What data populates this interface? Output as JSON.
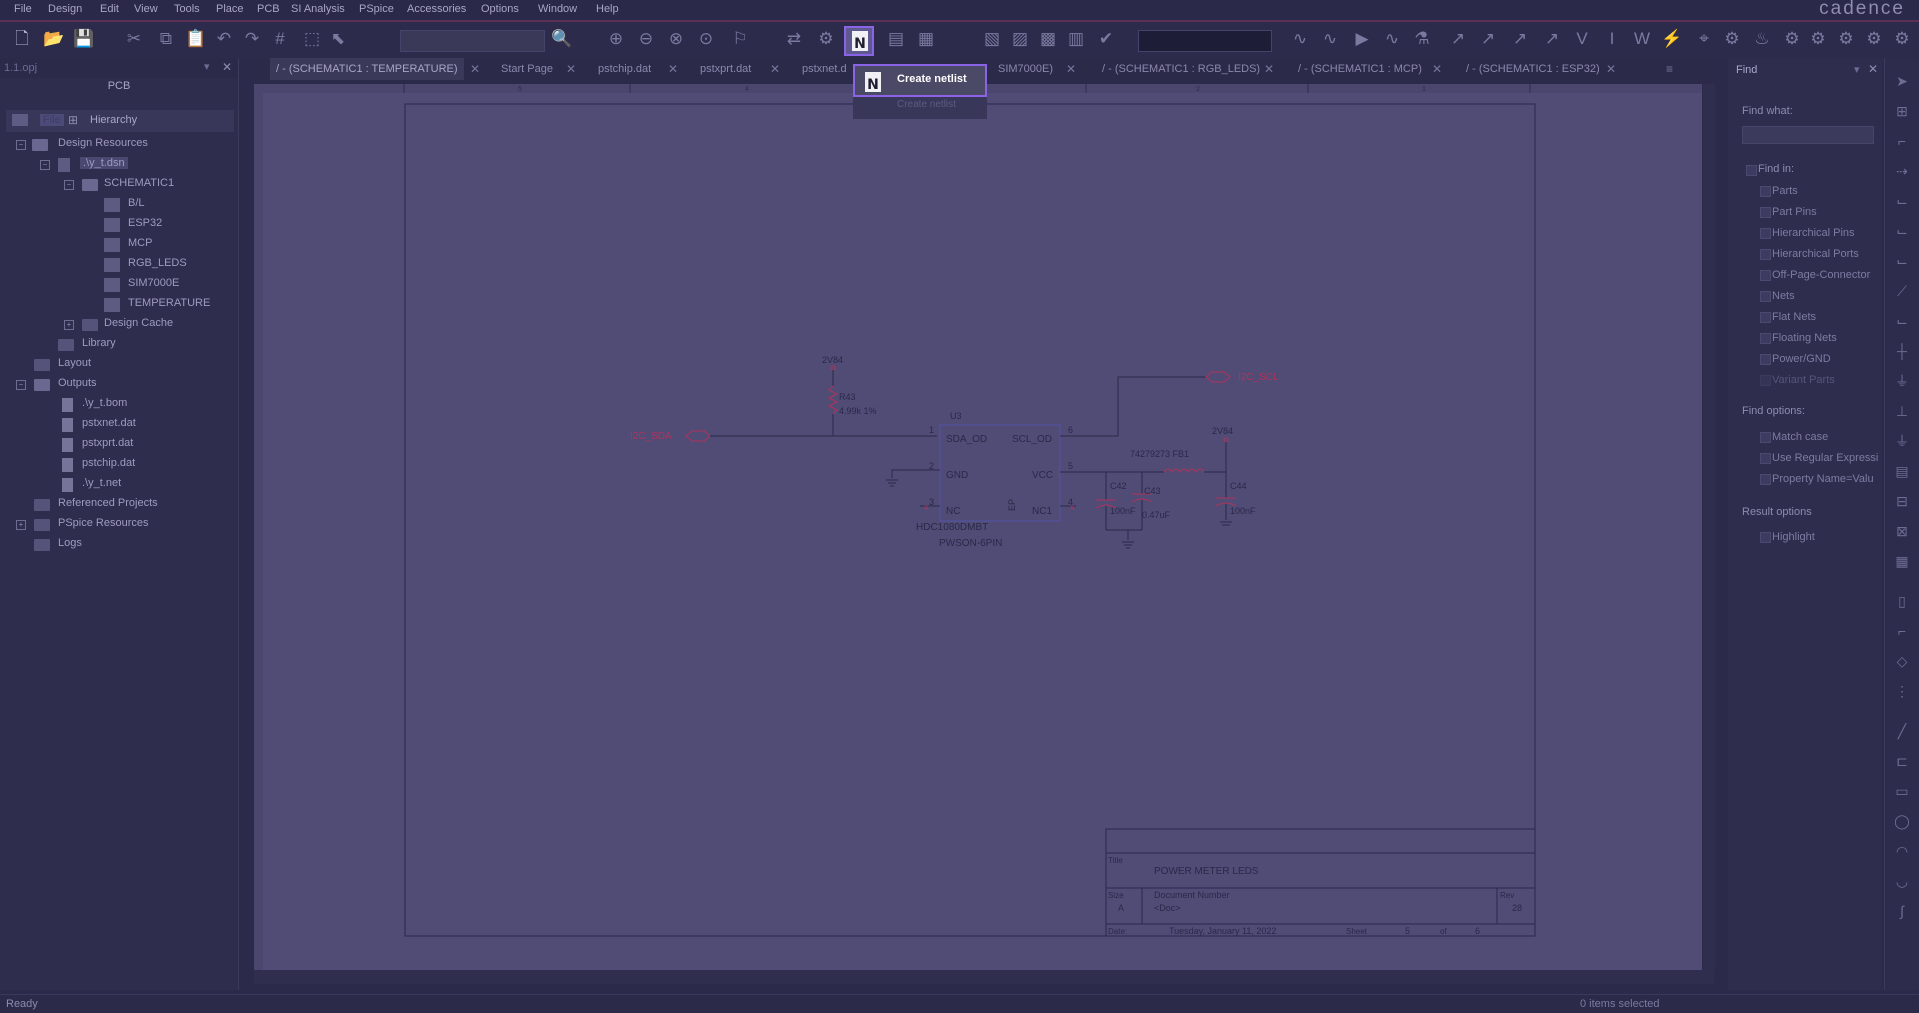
{
  "menubar": {
    "items": [
      "File",
      "Design",
      "Edit",
      "View",
      "Tools",
      "Place",
      "PCB",
      "SI Analysis",
      "PSpice",
      "Accessories",
      "Options",
      "Window",
      "Help"
    ],
    "brand": "cadence"
  },
  "project_tab": {
    "label": "1.1.opj"
  },
  "project_panel": {
    "title": "PCB",
    "view_tabs": [
      "File",
      "Hierarchy"
    ],
    "tree": [
      {
        "label": "Design Resources",
        "icon": "folder-icon",
        "expanded": true
      },
      {
        "label": ".\\y_t.dsn",
        "icon": "design-file-icon",
        "expanded": true
      },
      {
        "label": "SCHEMATIC1",
        "icon": "folder-icon",
        "expanded": true
      },
      {
        "label": "B/L",
        "icon": "schematic-page-icon"
      },
      {
        "label": "ESP32",
        "icon": "schematic-page-icon"
      },
      {
        "label": "MCP",
        "icon": "schematic-page-icon"
      },
      {
        "label": "RGB_LEDS",
        "icon": "schematic-page-icon"
      },
      {
        "label": "SIM7000E",
        "icon": "schematic-page-icon"
      },
      {
        "label": "TEMPERATURE",
        "icon": "schematic-page-icon"
      },
      {
        "label": "Design Cache",
        "icon": "folder-icon",
        "expanded": false
      },
      {
        "label": "Library",
        "icon": "folder-icon"
      },
      {
        "label": "Layout",
        "icon": "folder-icon"
      },
      {
        "label": "Outputs",
        "icon": "folder-icon",
        "expanded": true
      },
      {
        "label": ".\\y_t.bom",
        "icon": "file-icon"
      },
      {
        "label": "pstxnet.dat",
        "icon": "file-icon"
      },
      {
        "label": "pstxprt.dat",
        "icon": "file-icon"
      },
      {
        "label": "pstchip.dat",
        "icon": "file-icon"
      },
      {
        "label": ".\\y_t.net",
        "icon": "file-icon"
      },
      {
        "label": "Referenced Projects",
        "icon": "folder-icon"
      },
      {
        "label": "PSpice Resources",
        "icon": "folder-icon",
        "expanded": false
      },
      {
        "label": "Logs",
        "icon": "folder-icon"
      }
    ]
  },
  "doc_tabs": [
    {
      "label": "/ - (SCHEMATIC1 : TEMPERATURE)",
      "active": true
    },
    {
      "label": "Start Page"
    },
    {
      "label": "pstchip.dat"
    },
    {
      "label": "pstxprt.dat"
    },
    {
      "label": "pstxnet.d"
    },
    {
      "label": "SIM7000E)"
    },
    {
      "label": "/ - (SCHEMATIC1 : RGB_LEDS)"
    },
    {
      "label": "/ - (SCHEMATIC1 : MCP)"
    },
    {
      "label": "/ - (SCHEMATIC1 : ESP32)"
    }
  ],
  "tooltip": {
    "label": "Create netlist",
    "shadow_label": "Create netlist"
  },
  "schematic": {
    "zone_numbers": [
      "5",
      "4",
      "3",
      "2",
      "1"
    ],
    "net_sda": "I2C_SDA",
    "net_scl": "I2C_SCL",
    "power_label_1": "2V84",
    "power_label_2": "2V84",
    "r43_ref": "R43",
    "r43_value": "4.99k 1%",
    "u3_ref": "U3",
    "u3_part": "HDC1080DMBT",
    "u3_package": "PWSON-6PIN",
    "pins": {
      "p1_num": "1",
      "p1_name": "SDA_OD",
      "p2_num": "2",
      "p2_name": "GND",
      "p3_num": "3",
      "p3_name": "NC",
      "p4_num": "4",
      "p4_name": "NC1",
      "p5_num": "5",
      "p5_name": "VCC",
      "p6_num": "6",
      "p6_name": "SCL_OD",
      "ep": "EP"
    },
    "fb1_label": "74279273 FB1",
    "c42_ref": "C42",
    "c42_value": "100nF",
    "c43_ref": "C43",
    "c43_value": "0.47uF",
    "c44_ref": "C44",
    "c44_value": "100nF",
    "titleblock": {
      "title_label": "Title",
      "title": "POWER METER LEDS",
      "size_label": "Size",
      "size": "A",
      "docnum_label": "Document Number",
      "docnum": "<Doc>",
      "rev_label": "Rev",
      "rev": "28",
      "date_label": "Date:",
      "date": "Tuesday, January 11, 2022",
      "sheet_label": "Sheet",
      "sheet": "5",
      "of_label": "of",
      "sheets": "6"
    }
  },
  "find_panel": {
    "title": "Find",
    "find_what_label": "Find what:",
    "find_what_value": "",
    "find_in_label": "Find in:",
    "find_in_items": [
      "Parts",
      "Part Pins",
      "Hierarchical Pins",
      "Hierarchical Ports",
      "Off-Page-Connector",
      "Nets",
      "Flat Nets",
      "Floating Nets",
      "Power/GND",
      "Variant Parts"
    ],
    "find_options_label": "Find options:",
    "find_options_items": [
      "Match case",
      "Use Regular Expressi",
      "Property Name=Valu"
    ],
    "result_options_label": "Result options",
    "result_options_items": [
      "Highlight"
    ]
  },
  "status": {
    "left": "Ready",
    "right": "0 items selected"
  }
}
